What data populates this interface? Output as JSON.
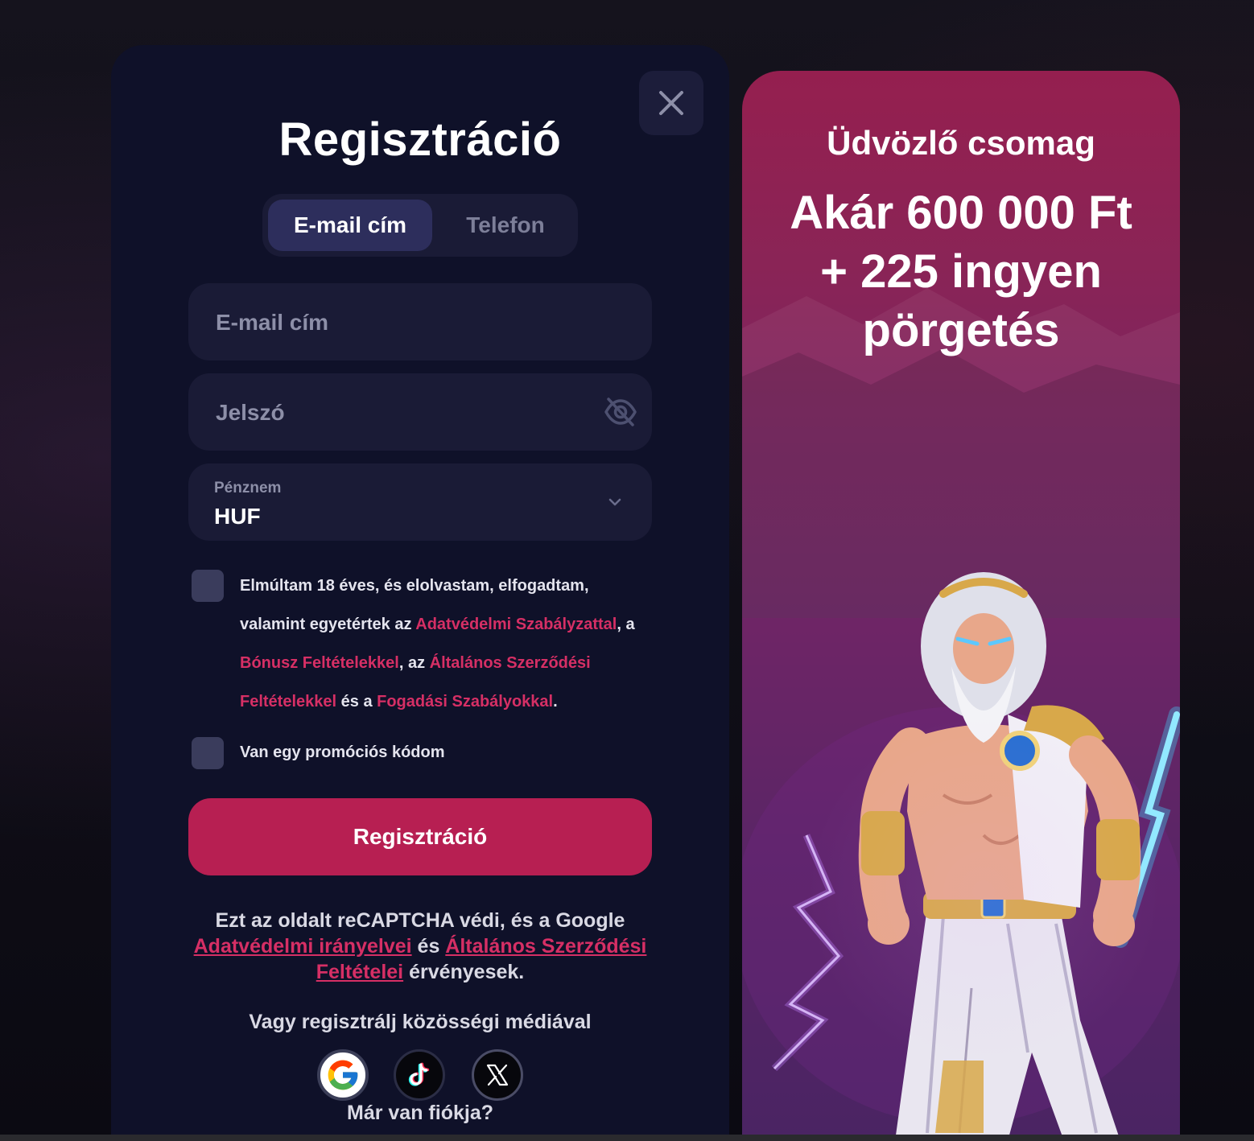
{
  "register": {
    "title": "Regisztráció",
    "tabs": [
      {
        "label": "E-mail cím",
        "active": true
      },
      {
        "label": "Telefon",
        "active": false
      }
    ],
    "email_placeholder": "E-mail cím",
    "password_placeholder": "Jelszó",
    "currency": {
      "label": "Pénznem",
      "value": "HUF"
    },
    "terms": {
      "t1": "Elmúltam 18 éves, és elolvastam, elfogadtam, valamint egyetértek az ",
      "link_privacy": "Adatvédelmi Szabályzattal",
      "t2": ", a ",
      "link_bonus": "Bónusz Feltételekkel",
      "t3": ", az ",
      "link_general": "Általános Szerződési Feltételekkel",
      "t4": " és a ",
      "link_betting": "Fogadási Szabályokkal",
      "t5": "."
    },
    "promo_code_label": "Van egy promóciós kódom",
    "submit_label": "Regisztráció",
    "captcha": {
      "t1": "Ezt az oldalt reCAPTCHA védi, és a Google ",
      "link_privacy": "Adatvédelmi irányelvei",
      "t2": " és ",
      "link_terms": "Általános Szerződési Feltételei",
      "t3": " érvényesek."
    },
    "social_title": "Vagy regisztrálj közösségi médiával",
    "social_icons": [
      "google-icon",
      "tiktok-icon",
      "x-icon"
    ],
    "login_prompt": "Már van fiókja?"
  },
  "promo": {
    "subtitle": "Üdvözlő csomag",
    "headline_line1": "Akár 600 000 Ft",
    "headline_line2": "+ 225 ingyen",
    "headline_line3": "pörgetés"
  },
  "colors": {
    "panel_bg": "#0f1129",
    "field_bg": "#1a1b36",
    "accent": "#b71f52",
    "link": "#d62f65"
  }
}
